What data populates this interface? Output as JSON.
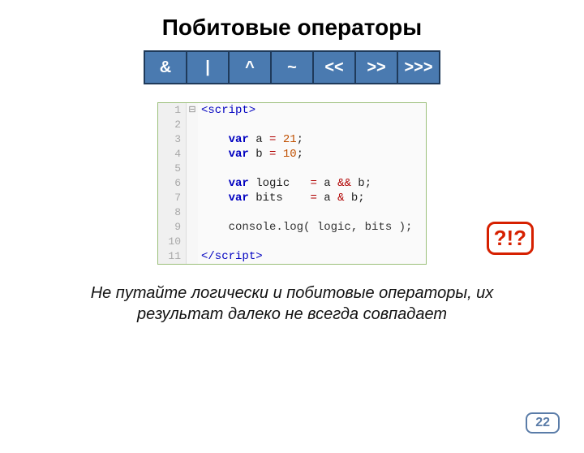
{
  "title": "Побитовые операторы",
  "operators": [
    "&",
    "|",
    "^",
    "~",
    "<<",
    ">>",
    ">>>"
  ],
  "code": {
    "lines": [
      {
        "n": "1",
        "fold": "⊟",
        "parts": [
          {
            "t": "<script>",
            "cls": "tag"
          }
        ]
      },
      {
        "n": "2",
        "fold": "",
        "parts": []
      },
      {
        "n": "3",
        "fold": "",
        "parts": [
          {
            "t": "    ",
            "cls": ""
          },
          {
            "t": "var",
            "cls": "kw"
          },
          {
            "t": " a ",
            "cls": ""
          },
          {
            "t": "=",
            "cls": "op"
          },
          {
            "t": " ",
            "cls": ""
          },
          {
            "t": "21",
            "cls": "num"
          },
          {
            "t": ";",
            "cls": ""
          }
        ]
      },
      {
        "n": "4",
        "fold": "",
        "parts": [
          {
            "t": "    ",
            "cls": ""
          },
          {
            "t": "var",
            "cls": "kw"
          },
          {
            "t": " b ",
            "cls": ""
          },
          {
            "t": "=",
            "cls": "op"
          },
          {
            "t": " ",
            "cls": ""
          },
          {
            "t": "10",
            "cls": "num"
          },
          {
            "t": ";",
            "cls": ""
          }
        ]
      },
      {
        "n": "5",
        "fold": "",
        "parts": []
      },
      {
        "n": "6",
        "fold": "",
        "parts": [
          {
            "t": "    ",
            "cls": ""
          },
          {
            "t": "var",
            "cls": "kw"
          },
          {
            "t": " logic   ",
            "cls": ""
          },
          {
            "t": "=",
            "cls": "op"
          },
          {
            "t": " a ",
            "cls": ""
          },
          {
            "t": "&&",
            "cls": "op"
          },
          {
            "t": " b;",
            "cls": ""
          }
        ]
      },
      {
        "n": "7",
        "fold": "",
        "parts": [
          {
            "t": "    ",
            "cls": ""
          },
          {
            "t": "var",
            "cls": "kw"
          },
          {
            "t": " bits    ",
            "cls": ""
          },
          {
            "t": "=",
            "cls": "op"
          },
          {
            "t": " a ",
            "cls": ""
          },
          {
            "t": "&",
            "cls": "op"
          },
          {
            "t": " b;",
            "cls": ""
          }
        ]
      },
      {
        "n": "8",
        "fold": "",
        "parts": []
      },
      {
        "n": "9",
        "fold": "",
        "parts": [
          {
            "t": "    console.log( logic, bits );",
            "cls": "fn"
          }
        ]
      },
      {
        "n": "10",
        "fold": "",
        "parts": []
      },
      {
        "n": "11",
        "fold": "",
        "parts": [
          {
            "t": "</scr",
            "cls": "tag"
          },
          {
            "t": "ipt>",
            "cls": "tag"
          }
        ]
      }
    ]
  },
  "callout": "?!?",
  "note": "Не путайте логически и побитовые операторы, их результат далеко не всегда совпадает",
  "page": "22"
}
